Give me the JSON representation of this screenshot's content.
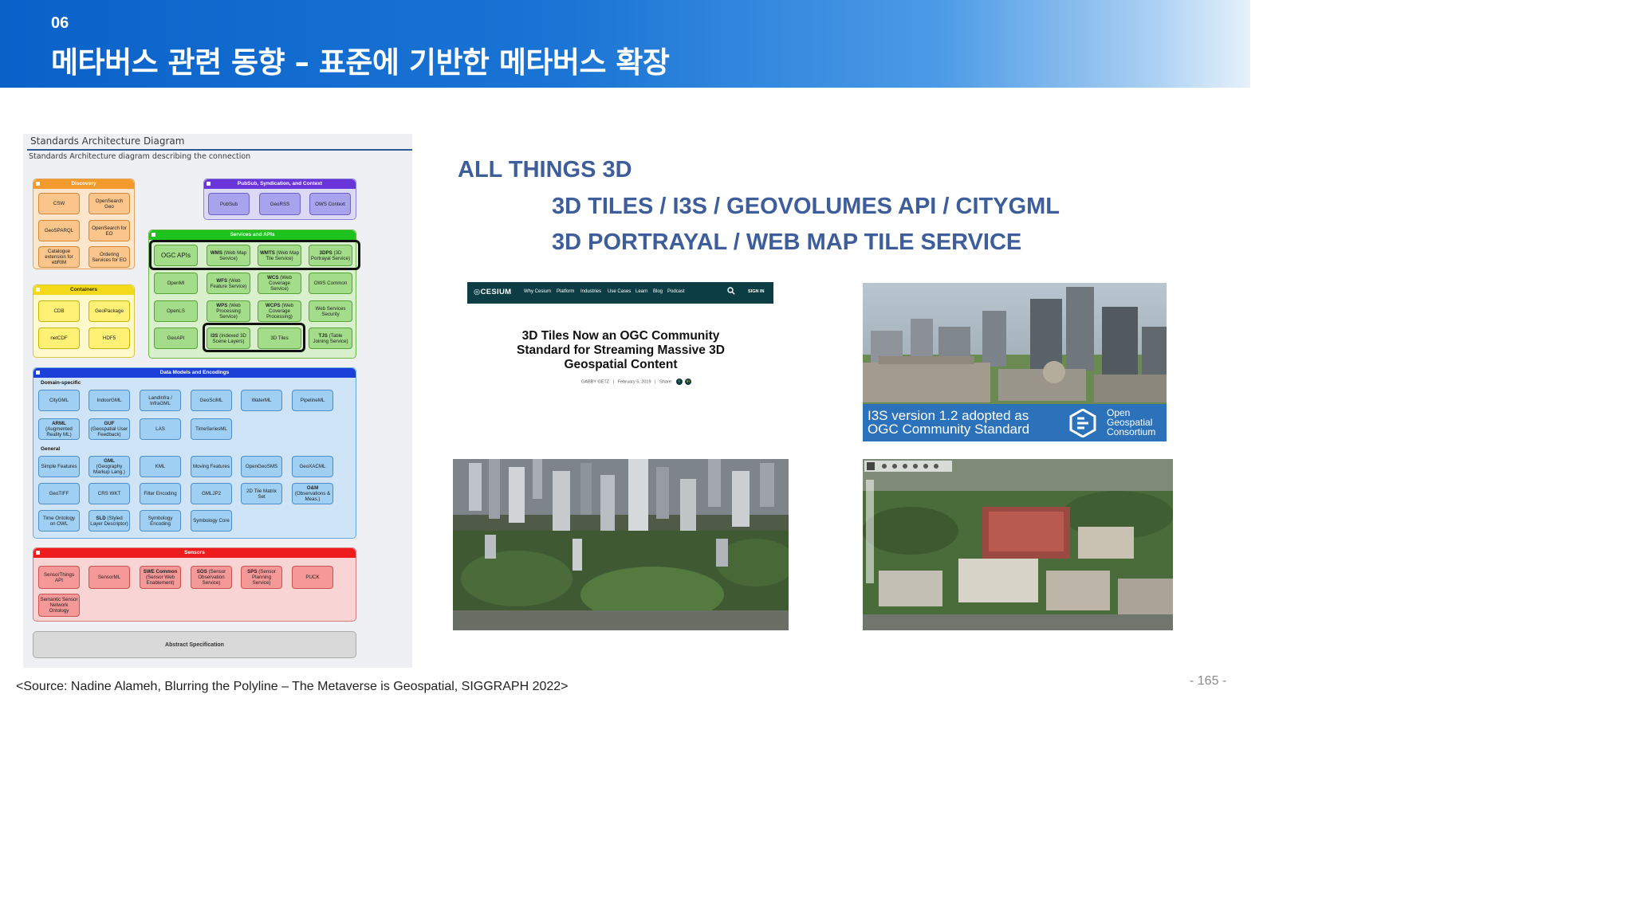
{
  "header": {
    "section_number": "06",
    "title": "메타버스 관련 동향 – 표준에 기반한 메타버스 확장"
  },
  "diagram": {
    "title": "Standards Architecture Diagram",
    "subtitle": "Standards Architecture diagram describing the connection",
    "groups": {
      "discovery": "Discovery",
      "pubsub": "PubSub, Syndication, and Context",
      "services": "Services and APIs",
      "containers": "Containers",
      "data_models": "Data Models and Encodings",
      "sensors": "Sensors",
      "abstract": "Abstract Specification"
    },
    "sublabels": {
      "domain_specific": "Domain-specific",
      "general": "General"
    },
    "discovery_items": [
      "CSW",
      "OpenSearch Geo",
      "GeoSPARQL",
      "OpenSearch for EO",
      "Catalogue extension for ebRIM",
      "Ordering Services for EO"
    ],
    "pubsub_items": [
      "PubSub",
      "GeoRSS",
      "OWS Context"
    ],
    "services_items": {
      "ogc_apis": "OGC APIs",
      "wms_b": "WMS",
      "wms_t": "(Web Map Service)",
      "wmts_b": "WMTS",
      "wmts_t": "(Web Map Tile Service)",
      "3dps_b": "3DPS",
      "3dps_t": "(3D Portrayal Service)",
      "openmi": "OpenMI",
      "wfs_b": "WFS",
      "wfs_t": "(Web Feature Service)",
      "wcs_b": "WCS",
      "wcs_t": "(Web Coverage Service)",
      "ows_common": "OWS Common",
      "openls": "OpenLS",
      "wps_b": "WPS",
      "wps_t": "(Web Processing Service)",
      "wcps_b": "WCPS",
      "wcps_t": "(Web Coverage Processing)",
      "ws_security": "Web Services Security",
      "geoapi": "GeoAPI",
      "i3s_b": "I3S",
      "i3s_t": "(Indexed 3D Scene Layers)",
      "3dtiles": "3D Tiles",
      "tjs_b": "TJS",
      "tjs_t": "(Table Joining Service)"
    },
    "container_items": [
      "CDB",
      "GeoPackage",
      "netCDF",
      "HDF5"
    ],
    "domain_items": [
      "CityGML",
      "IndoorGML",
      "LandInfra / InfraGML",
      "GeoSciML",
      "WaterML",
      "PipelineML"
    ],
    "domain_items2": {
      "arml_b": "ARML",
      "arml_t": "(Augmented Reality ML)",
      "guf_b": "GUF",
      "guf_t": "(Geospatial User Feedback)",
      "las": "LAS",
      "timeseries": "TimeSeriesML"
    },
    "general_items": {
      "simple_features": "Simple Features",
      "gml_b": "GML",
      "gml_t": "(Geography Markup Lang.)",
      "kml": "KML",
      "moving": "Moving Features",
      "opengeosms": "OpenGeoSMS",
      "geoxacml": "GeoXACML",
      "geotiff": "GeoTIFF",
      "crs_wkt": "CRS WKT",
      "filter": "Filter Encoding",
      "gmljp2": "GMLJP2",
      "tilematrix": "2D Tile Matrix Set",
      "om_b": "O&M",
      "om_t": "(Observations & Meas.)",
      "time_ontology": "Time Ontology on OWL",
      "sld_b": "SLD",
      "sld_t": "(Styled Layer Descriptor)",
      "symb_enc": "Symbology Encoding",
      "symb_core": "Symbology Core"
    },
    "sensor_items": {
      "sensorthings": "SensorThings API",
      "sensorml": "SensorML",
      "swe_b": "SWE Common",
      "swe_t": "(Sensor Web Enablement)",
      "sos_b": "SOS",
      "sos_t": "(Sensor Observation Service)",
      "sps_b": "SPS",
      "sps_t": "(Sensor Planning Service)",
      "puck": "PUCK",
      "ssn": "Semantic Sensor Network Ontology"
    }
  },
  "right_text": {
    "line1": "ALL THINGS 3D",
    "line2": "3D TILES / I3S / GEOVOLUMES API / CITYGML",
    "line3": "3D PORTRAYAL / WEB MAP TILE SERVICE"
  },
  "cesium_card": {
    "logo": "CESIUM",
    "nav": [
      "Why Cesium",
      "Platform",
      "Industries",
      "Use Cases",
      "Learn",
      "Blog",
      "Podcast"
    ],
    "sign_in": "SIGN IN",
    "headline_1": "3D Tiles Now an OGC Community",
    "headline_2": "Standard for Streaming Massive 3D",
    "headline_3": "Geospatial Content",
    "author": "GABBY GETZ",
    "date": "February 5, 2019",
    "share": "Share:"
  },
  "i3s_image": {
    "line1": "I3S version 1.2 adopted as",
    "line2": "OGC Community Standard",
    "org_1": "Open",
    "org_2": "Geospatial",
    "org_3": "Consortium"
  },
  "footer": {
    "source": "<Source: Nadine Alameh, Blurring the Polyline – The Metaverse is Geospatial, SIGGRAPH 2022>",
    "page": "- 165 -"
  },
  "colors": {
    "header_blue": "#0a62c9",
    "accent_text": "#3d5d9b",
    "discovery": "#fbc58b",
    "containers": "#fff176",
    "pubsub": "#a9a3ee",
    "services": "#a3dd8a",
    "data_models": "#9fd0f4",
    "sensors": "#f59898"
  }
}
